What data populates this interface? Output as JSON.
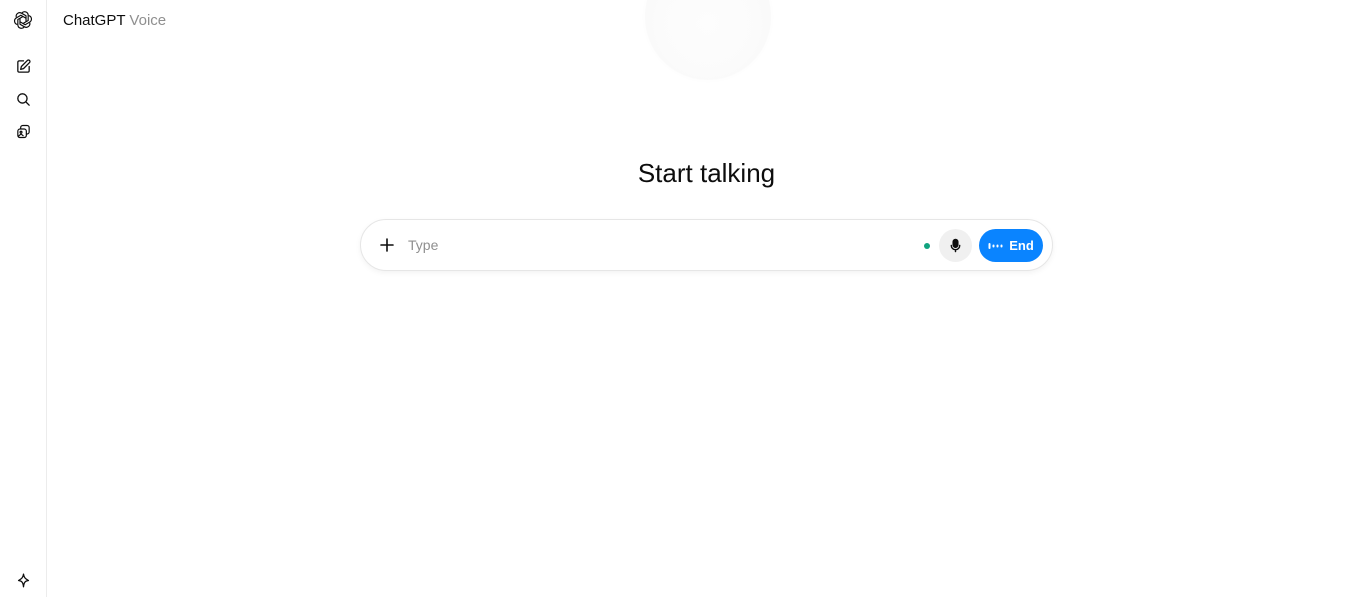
{
  "header": {
    "brand": "ChatGPT",
    "model": "Voice"
  },
  "sidebar": {
    "items": [
      {
        "name": "openai-logo-icon",
        "label": "ChatGPT"
      },
      {
        "name": "new-chat-icon",
        "label": "New chat"
      },
      {
        "name": "search-icon",
        "label": "Search chats"
      },
      {
        "name": "library-icon",
        "label": "Library"
      },
      {
        "name": "sparkle-icon",
        "label": "Upgrade"
      }
    ]
  },
  "main": {
    "heading": "Start talking"
  },
  "composer": {
    "placeholder": "Type",
    "end_label": "End",
    "status_color": "#10a37f",
    "accent_color": "#0a84ff"
  }
}
